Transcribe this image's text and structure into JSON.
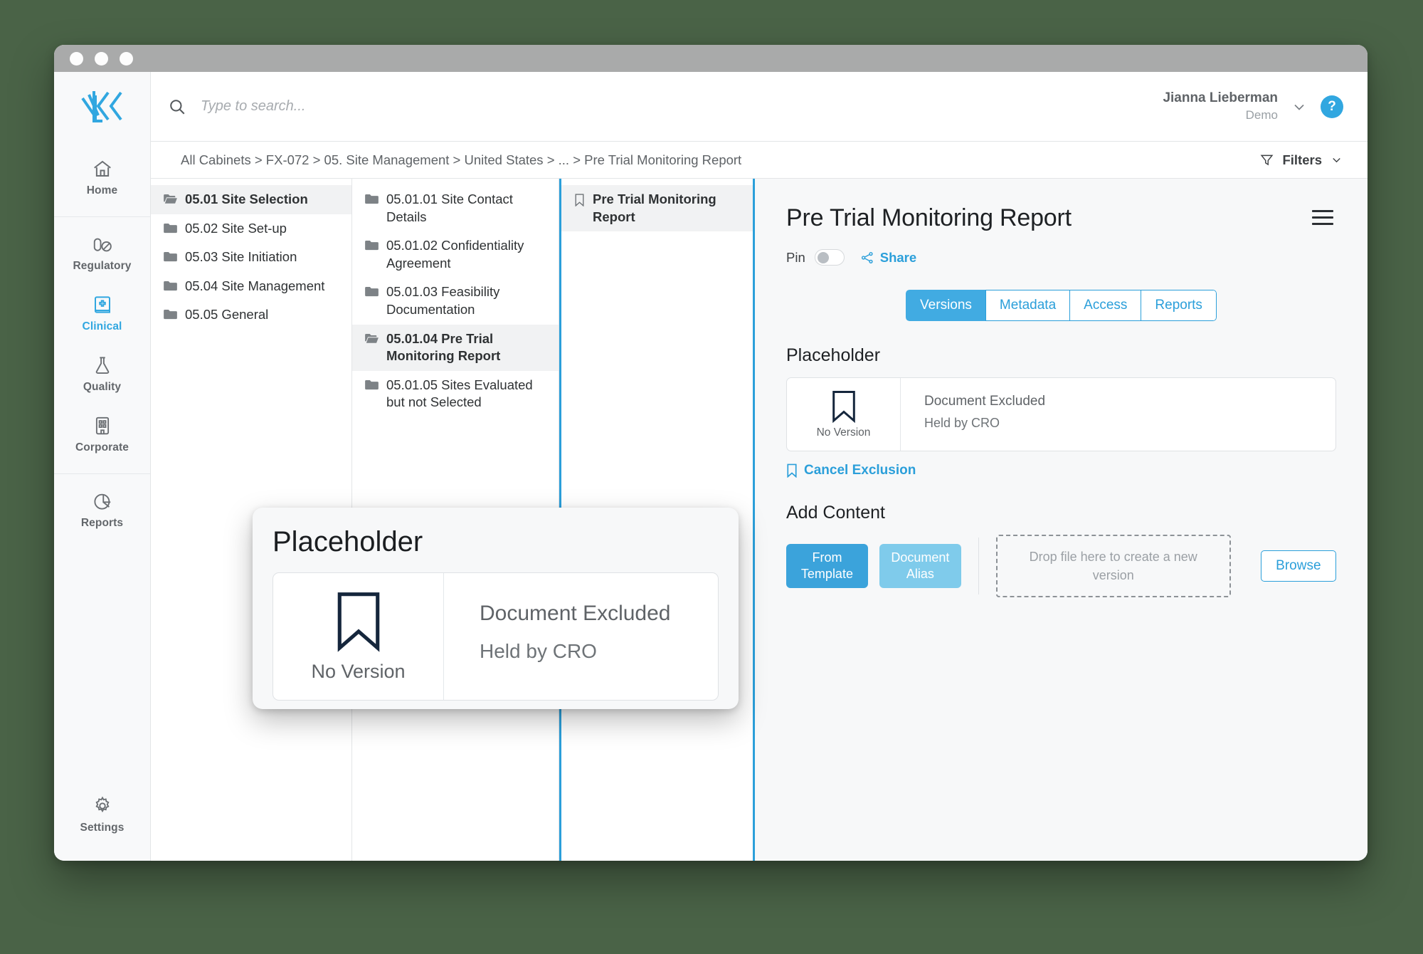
{
  "window": {
    "traffic_lights": [
      "close",
      "minimize",
      "maximize"
    ]
  },
  "brand": {
    "logo_name": "veeva-vault-logo",
    "accent": "#31a7e0"
  },
  "search": {
    "placeholder": "Type to search...",
    "value": "",
    "icon": "search-icon"
  },
  "user": {
    "name": "Jianna Lieberman",
    "org": "Demo",
    "help_label": "?",
    "chevron": "chevron-down-icon"
  },
  "breadcrumb": {
    "text": "All Cabinets > FX-072 > 05. Site Management > United States > ... > Pre Trial Monitoring Report"
  },
  "filters": {
    "label": "Filters",
    "icon": "filter-icon",
    "chevron": "chevron-down-icon"
  },
  "rail": {
    "groups": [
      {
        "items": [
          {
            "label": "Home",
            "icon": "home-icon",
            "active": false
          }
        ]
      },
      {
        "items": [
          {
            "label": "Regulatory",
            "icon": "pill-icon",
            "active": false
          },
          {
            "label": "Clinical",
            "icon": "medical-book-icon",
            "active": true
          },
          {
            "label": "Quality",
            "icon": "flask-icon",
            "active": false
          },
          {
            "label": "Corporate",
            "icon": "building-icon",
            "active": false
          }
        ]
      },
      {
        "items": [
          {
            "label": "Reports",
            "icon": "pie-chart-icon",
            "active": false
          }
        ]
      }
    ],
    "bottom": {
      "label": "Settings",
      "icon": "gear-icon"
    }
  },
  "column1": {
    "nodes": [
      {
        "label": "05.01 Site Selection",
        "icon": "folder-open-icon",
        "selected": true
      },
      {
        "label": "05.02 Site Set-up",
        "icon": "folder-icon",
        "selected": false
      },
      {
        "label": "05.03 Site Initiation",
        "icon": "folder-icon",
        "selected": false
      },
      {
        "label": "05.04 Site Management",
        "icon": "folder-icon",
        "selected": false
      },
      {
        "label": "05.05 General",
        "icon": "folder-icon",
        "selected": false
      }
    ]
  },
  "column2": {
    "nodes": [
      {
        "label": "05.01.01 Site Contact Details",
        "icon": "folder-icon",
        "selected": false
      },
      {
        "label": "05.01.02 Confidentiality Agreement",
        "icon": "folder-icon",
        "selected": false
      },
      {
        "label": "05.01.03 Feasibility Documentation",
        "icon": "folder-icon",
        "selected": false
      },
      {
        "label": "05.01.04 Pre Trial Monitoring Report",
        "icon": "folder-open-icon",
        "selected": true
      },
      {
        "label": "05.01.05 Sites Evaluated but not Selected",
        "icon": "folder-icon",
        "selected": false
      }
    ]
  },
  "column3": {
    "nodes": [
      {
        "label": "Pre Trial Monitoring Report",
        "icon": "bookmark-icon",
        "selected": true
      }
    ]
  },
  "detail": {
    "title": "Pre Trial Monitoring Report",
    "menu_icon": "hamburger-menu-icon",
    "pin": {
      "label": "Pin",
      "state": "off"
    },
    "share": {
      "label": "Share",
      "icon": "share-icon"
    },
    "tabs": [
      {
        "label": "Versions",
        "active": true
      },
      {
        "label": "Metadata",
        "active": false
      },
      {
        "label": "Access",
        "active": false
      },
      {
        "label": "Reports",
        "active": false
      }
    ],
    "placeholder": {
      "section_title": "Placeholder",
      "no_version": "No Version",
      "excluded": "Document Excluded",
      "held_by": "Held by CRO",
      "icon": "bookmark-icon",
      "cancel": {
        "label": "Cancel Exclusion",
        "icon": "bookmark-icon"
      }
    },
    "add_content": {
      "section_title": "Add Content",
      "from_template": "From Template",
      "document_alias": "Document Alias",
      "dropzone": "Drop file here to create a new version",
      "browse": "Browse"
    }
  },
  "magnifier": {
    "title": "Placeholder",
    "no_version": "No Version",
    "excluded": "Document Excluded",
    "held_by": "Held by CRO",
    "icon": "bookmark-icon"
  }
}
